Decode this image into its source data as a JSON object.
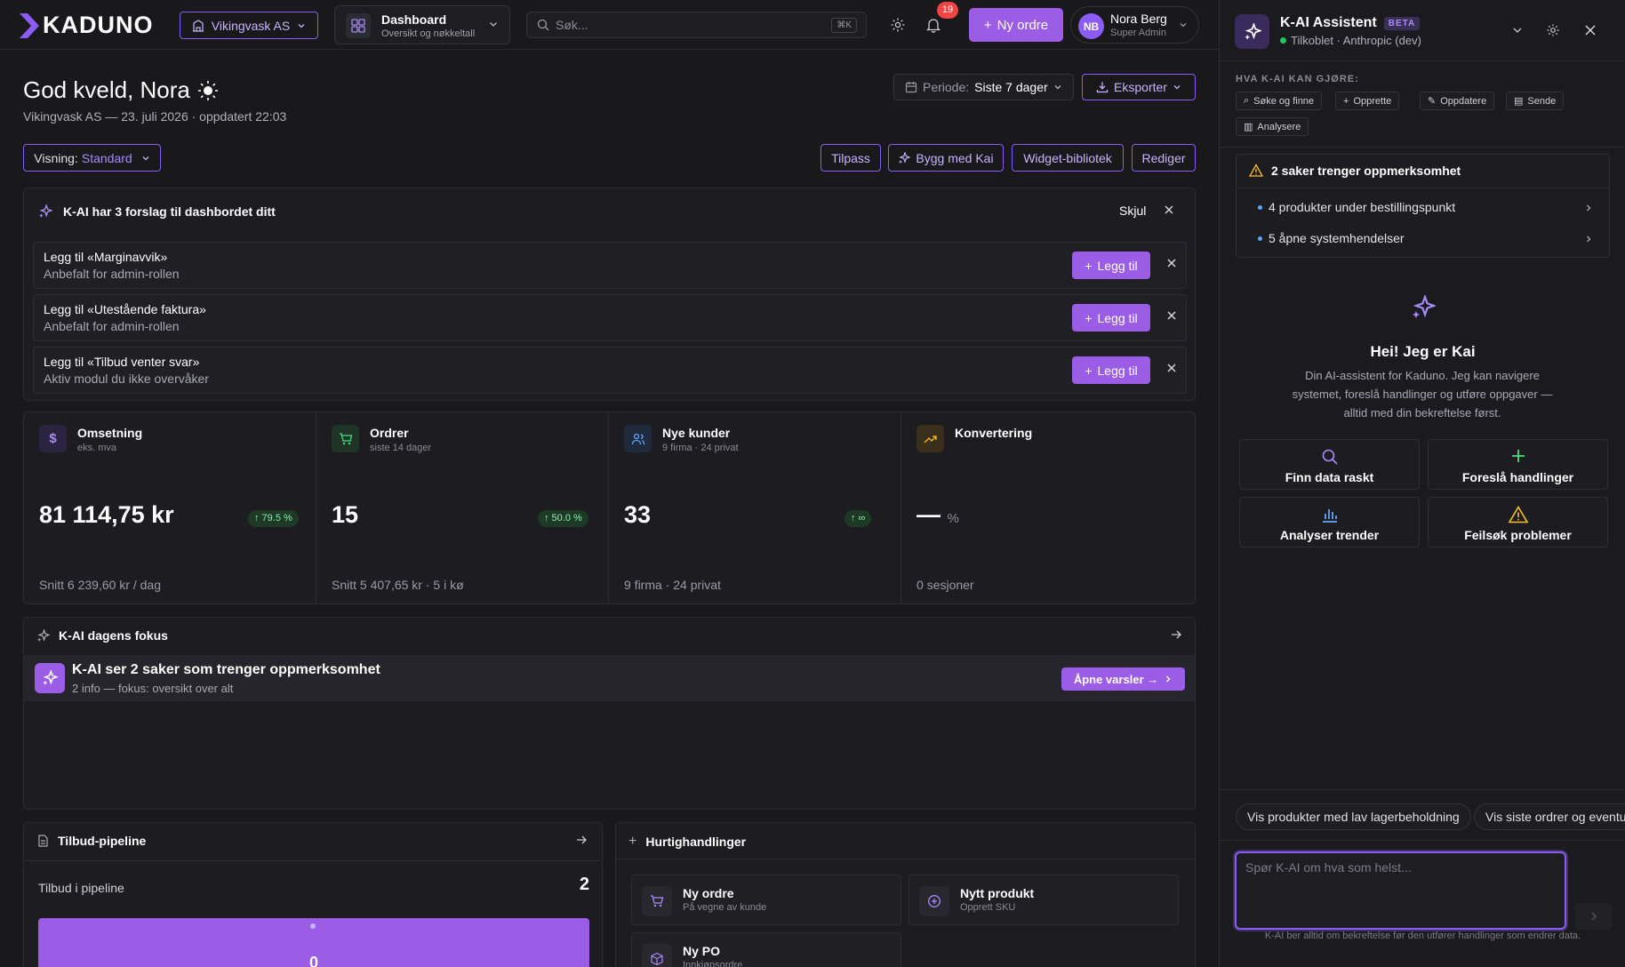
{
  "header": {
    "brand": "KADUNO",
    "company": "Vikingvask AS",
    "dashboard_title": "Dashboard",
    "dashboard_sub": "Oversikt og nøkkeltall",
    "search_placeholder": "Søk...",
    "search_kbd": "⌘K",
    "notif_count": "19",
    "new_order": "Ny ordre",
    "user_initials": "NB",
    "user_name": "Nora Berg",
    "user_role": "Super Admin"
  },
  "page": {
    "greeting": "God kveld, Nora",
    "subtitle": "Vikingvask AS — 23. juli 2026 · oppdatert 22:03",
    "periode_label": "Periode:",
    "periode_value": "Siste 7 dager",
    "export": "Eksporter",
    "visning_label": "Visning:",
    "visning_value": "Standard",
    "actions": [
      "Tilpass",
      "Bygg med Kai",
      "Widget-bibliotek",
      "Rediger"
    ]
  },
  "suggestions": {
    "title": "K-AI har 3 forslag til dashbordet ditt",
    "hide": "Skjul",
    "add_label": "Legg til",
    "items": [
      {
        "title": "Legg til «Marginavvik»",
        "sub": "Anbefalt for admin-rollen"
      },
      {
        "title": "Legg til «Utestående faktura»",
        "sub": "Anbefalt for admin-rollen"
      },
      {
        "title": "Legg til «Tilbud venter svar»",
        "sub": "Aktiv modul du ikke overvåker"
      }
    ]
  },
  "kpis": [
    {
      "title": "Omsetning",
      "sub": "eks. mva",
      "value": "81 114,75 kr",
      "badge": "↑ 79.5 %",
      "foot": "Snitt 6 239,60 kr / dag",
      "color": "#8b5cf6"
    },
    {
      "title": "Ordrer",
      "sub": "siste 14 dager",
      "value": "15",
      "badge": "↑ 50.0 %",
      "foot": "Snitt 5 407,65 kr · 5 i kø",
      "color": "#22c55e"
    },
    {
      "title": "Nye kunder",
      "sub": "9 firma · 24 privat",
      "value": "33",
      "badge": "↑ ∞",
      "foot": "9 firma · 24 privat",
      "color": "#60a5fa"
    },
    {
      "title": "Konvertering",
      "sub": "",
      "value": "—",
      "value_unit": "%",
      "badge": "",
      "foot": "0 sesjoner",
      "color": "#f59e0b"
    }
  ],
  "focus": {
    "title": "K-AI dagens fokus",
    "headline": "K-AI ser 2 saker som trenger oppmerksomhet",
    "sub": "2 info — fokus: oversikt over alt",
    "button": "Åpne varsler →"
  },
  "pipeline": {
    "title": "Tilbud-pipeline",
    "label": "Tilbud i pipeline",
    "count": "2",
    "bar_value": "0"
  },
  "quick": {
    "title": "Hurtighandlinger",
    "items": [
      {
        "title": "Ny ordre",
        "sub": "På vegne av kunde"
      },
      {
        "title": "Nytt produkt",
        "sub": "Opprett SKU"
      },
      {
        "title": "Ny PO",
        "sub": "Innkjøpsordre"
      }
    ]
  },
  "panel": {
    "title": "K-AI Assistent",
    "beta": "BETA",
    "status": "Tilkoblet · Anthropic (dev)",
    "can_do": "HVA K-AI KAN GJØRE:",
    "chips": [
      "Søke og finne",
      "Opprette",
      "Oppdatere",
      "Sende",
      "Analysere"
    ],
    "attention_title": "2 saker trenger oppmerksomhet",
    "attention_items": [
      "4 produkter under bestillingspunkt",
      "5 åpne systemhendelser"
    ],
    "hello_title": "Hei! Jeg er Kai",
    "hello_sub": "Din AI-assistent for Kaduno. Jeg kan navigere systemet, foreslå handlinger og utføre oppgaver — alltid med din bekreftelse først.",
    "buttons": [
      "Finn data raskt",
      "Foreslå handlinger",
      "Analyser trender",
      "Feilsøk problemer"
    ],
    "prompt_chips": [
      "Vis produkter med lav lagerbeholdning",
      "Vis siste ordrer og eventuelle"
    ],
    "input_placeholder": "Spør K-AI om hva som helst...",
    "footer": "K-AI ber alltid om bekreftelse før den utfører handlinger som endrer data."
  },
  "colors": {
    "accent": "#9b5de5",
    "bg": "#19191c",
    "danger": "#ef4444",
    "success": "#22c55e"
  }
}
